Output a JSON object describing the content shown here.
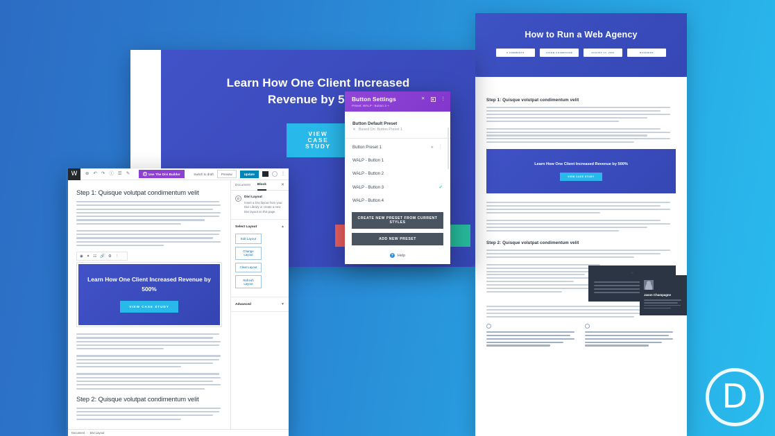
{
  "background": {
    "from": "#2c6cc4",
    "to": "#29bced"
  },
  "watermark": {
    "letter": "D",
    "name": "divi-logo"
  },
  "blog_preview": {
    "hero_title": "How to Run a Web Agency",
    "meta_chips": [
      "0 COMMENTS",
      "JASON CHAMPAGNE",
      "AUGUST 17, 2020",
      "BUSINESS"
    ],
    "heading_1": "Step 1: Quisque volutpat condimentum velit",
    "heading_2": "Step 2: Quisque volutpat condimentum velit",
    "cta_title": "Learn How One Client Increased Revenue by 500%",
    "cta_button": "VIEW CASE STUDY",
    "quote_mark": "“",
    "author": {
      "name": "Jason Champagne"
    }
  },
  "builder_page": {
    "banner_title": "Learn How One Client Increased Revenue by 500%",
    "banner_button": "VIEW CASE STUDY",
    "accent_button": "#29b8ea",
    "banner_bg": "#3b4fc0"
  },
  "modal": {
    "title": "Button Settings",
    "subtitle": "Preset: WALP - Button 3 +",
    "header_color": "#8e3fd4",
    "icons": {
      "close": "✕",
      "layout": "panel-icon",
      "more": "⋮"
    },
    "default_preset": {
      "label": "Button Default Preset",
      "based_on": "Based On: Button Preset 1",
      "star": "★"
    },
    "presets": [
      {
        "label": "Button Preset 1",
        "starred": true,
        "selected": false
      },
      {
        "label": "WALP - Button 1",
        "starred": false,
        "selected": false
      },
      {
        "label": "WALP - Button 2",
        "starred": false,
        "selected": false
      },
      {
        "label": "WALP - Button 3",
        "starred": false,
        "selected": true
      },
      {
        "label": "WALP - Button 4",
        "starred": false,
        "selected": false
      }
    ],
    "create_from_styles": "CREATE NEW PRESET FROM CURRENT STYLES",
    "add_new_preset": "ADD NEW PRESET",
    "help": "Help"
  },
  "wp_editor": {
    "logo": "W",
    "divi_builder_button": "Use The Divi Builder",
    "toolbar_icons": [
      "add-icon",
      "undo-icon",
      "redo-icon",
      "info-icon",
      "list-view-icon",
      "pencil-icon"
    ],
    "switch_to_draft": "Switch to draft",
    "preview": "Preview",
    "update": "Update",
    "heading_1": "Step 1: Quisque volutpat condimentum velit",
    "heading_2": "Step 2: Quisque volutpat condimentum velit",
    "cta_title": "Learn How One Client Increased Revenue by 500%",
    "cta_button": "VIEW CASE STUDY",
    "footer_breadcrumb": {
      "document": "Document",
      "separator": "›",
      "current": "Divi Layout"
    },
    "sidebar": {
      "tabs": [
        {
          "label": "Document",
          "active": false
        },
        {
          "label": "Block",
          "active": true
        }
      ],
      "close": "✕",
      "block": {
        "name": "Divi Layout",
        "description": "Insert a Divi layout from your Divi Library or create a new Divi layout on this page.",
        "icon": "divi-icon"
      },
      "select_layout": {
        "label": "Select Layout",
        "arrow": "▲"
      },
      "layout_buttons": [
        "Edit Layout",
        "Change Layout",
        "Clear Layout",
        "Refresh Layout"
      ],
      "advanced": {
        "label": "Advanced",
        "arrow": "▼"
      }
    }
  }
}
